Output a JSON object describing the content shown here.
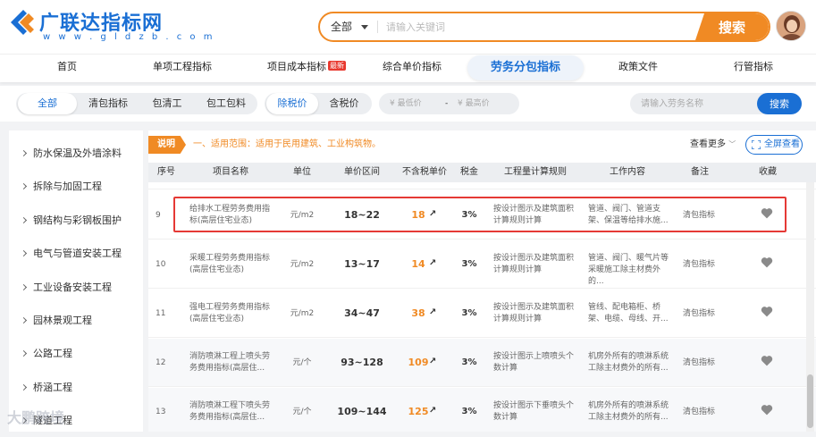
{
  "brand": {
    "name": "广联达指标网",
    "url": "w w w . g l d z b . c o m"
  },
  "search": {
    "category": "全部",
    "placeholder": "请输入关键词",
    "button": "搜索"
  },
  "nav": [
    {
      "label": "首页"
    },
    {
      "label": "单项工程指标"
    },
    {
      "label": "项目成本指标",
      "badge": "最新"
    },
    {
      "label": "综合单价指标"
    },
    {
      "label": "劳务分包指标",
      "active": true
    },
    {
      "label": "政策文件"
    },
    {
      "label": "行管指标"
    }
  ],
  "filters": {
    "scope": [
      "全部",
      "清包指标",
      "包清工",
      "包工包料"
    ],
    "scope_active": "全部",
    "tax": [
      "除税价",
      "含税价"
    ],
    "tax_active": "除税价",
    "min_price_placeholder": "最低价",
    "max_price_placeholder": "最高价",
    "currency": "¥",
    "range_sep": "-",
    "labor_search_placeholder": "请输入劳务名称",
    "labor_search_button": "搜索"
  },
  "sidebar": {
    "items": [
      {
        "label": "防水保温及外墙涂料"
      },
      {
        "label": "拆除与加固工程"
      },
      {
        "label": "钢结构与彩钢板围护"
      },
      {
        "label": "电气与管道安装工程"
      },
      {
        "label": "工业设备安装工程"
      },
      {
        "label": "园林景观工程"
      },
      {
        "label": "公路工程"
      },
      {
        "label": "桥涵工程"
      },
      {
        "label": "隧道工程"
      }
    ]
  },
  "notice": {
    "tag": "说明",
    "text": "一、适用范围：适用于民用建筑、工业构筑物。",
    "view_more": "查看更多",
    "fullscreen": "全屏查看"
  },
  "table": {
    "headers": {
      "no": "序号",
      "name": "项目名称",
      "unit": "单位",
      "range": "单价区间",
      "price": "不含税单价",
      "tax": "税金",
      "rule": "工程量计算规则",
      "work": "工作内容",
      "note": "备注",
      "fav": "收藏"
    },
    "rows": [
      {
        "no": "9",
        "name": "给排水工程劳务费用指标(高层住宅业态)",
        "unit": "元/m2",
        "range": "18~22",
        "price": "18",
        "tax": "3%",
        "rule": "按设计图示及建筑面积计算规则计算",
        "work": "管道、阀门、管道支架、保温等给排水施...",
        "note": "清包指标"
      },
      {
        "no": "10",
        "name": "采暖工程劳务费用指标(高层住宅业态)",
        "unit": "元/m2",
        "range": "13~17",
        "price": "14",
        "tax": "3%",
        "rule": "按设计图示及建筑面积计算规则计算",
        "work": "管道、阀门、暖气片等采暖施工除主材费外的...",
        "note": "清包指标"
      },
      {
        "no": "11",
        "name": "强电工程劳务费用指标(高层住宅业态)",
        "unit": "元/m2",
        "range": "34~47",
        "price": "38",
        "tax": "3%",
        "rule": "按设计图示及建筑面积计算规则计算",
        "work": "管线、配电箱柜、桥架、电缆、母线、开...",
        "note": "清包指标"
      },
      {
        "no": "12",
        "name": "消防喷淋工程上喷头劳务费用指标(高层住...",
        "unit": "元/个",
        "range": "93~128",
        "price": "109",
        "tax": "3%",
        "rule": "按设计图示上喷喷头个数计算",
        "work": "机房外所有的喷淋系统工除主材费外的所有...",
        "note": "清包指标"
      },
      {
        "no": "13",
        "name": "消防喷淋工程下喷头劳务费用指标(高层住...",
        "unit": "元/个",
        "range": "109~144",
        "price": "125",
        "tax": "3%",
        "rule": "按设计图示下垂喷头个数计算",
        "work": "机房外所有的喷淋系统工除主材费外的所有...",
        "note": "清包指标"
      }
    ]
  },
  "watermark": "大鹏跨境",
  "colors": {
    "brand_blue": "#1a6fd4",
    "accent_orange": "#f08a24",
    "highlight_red": "#e53935"
  }
}
